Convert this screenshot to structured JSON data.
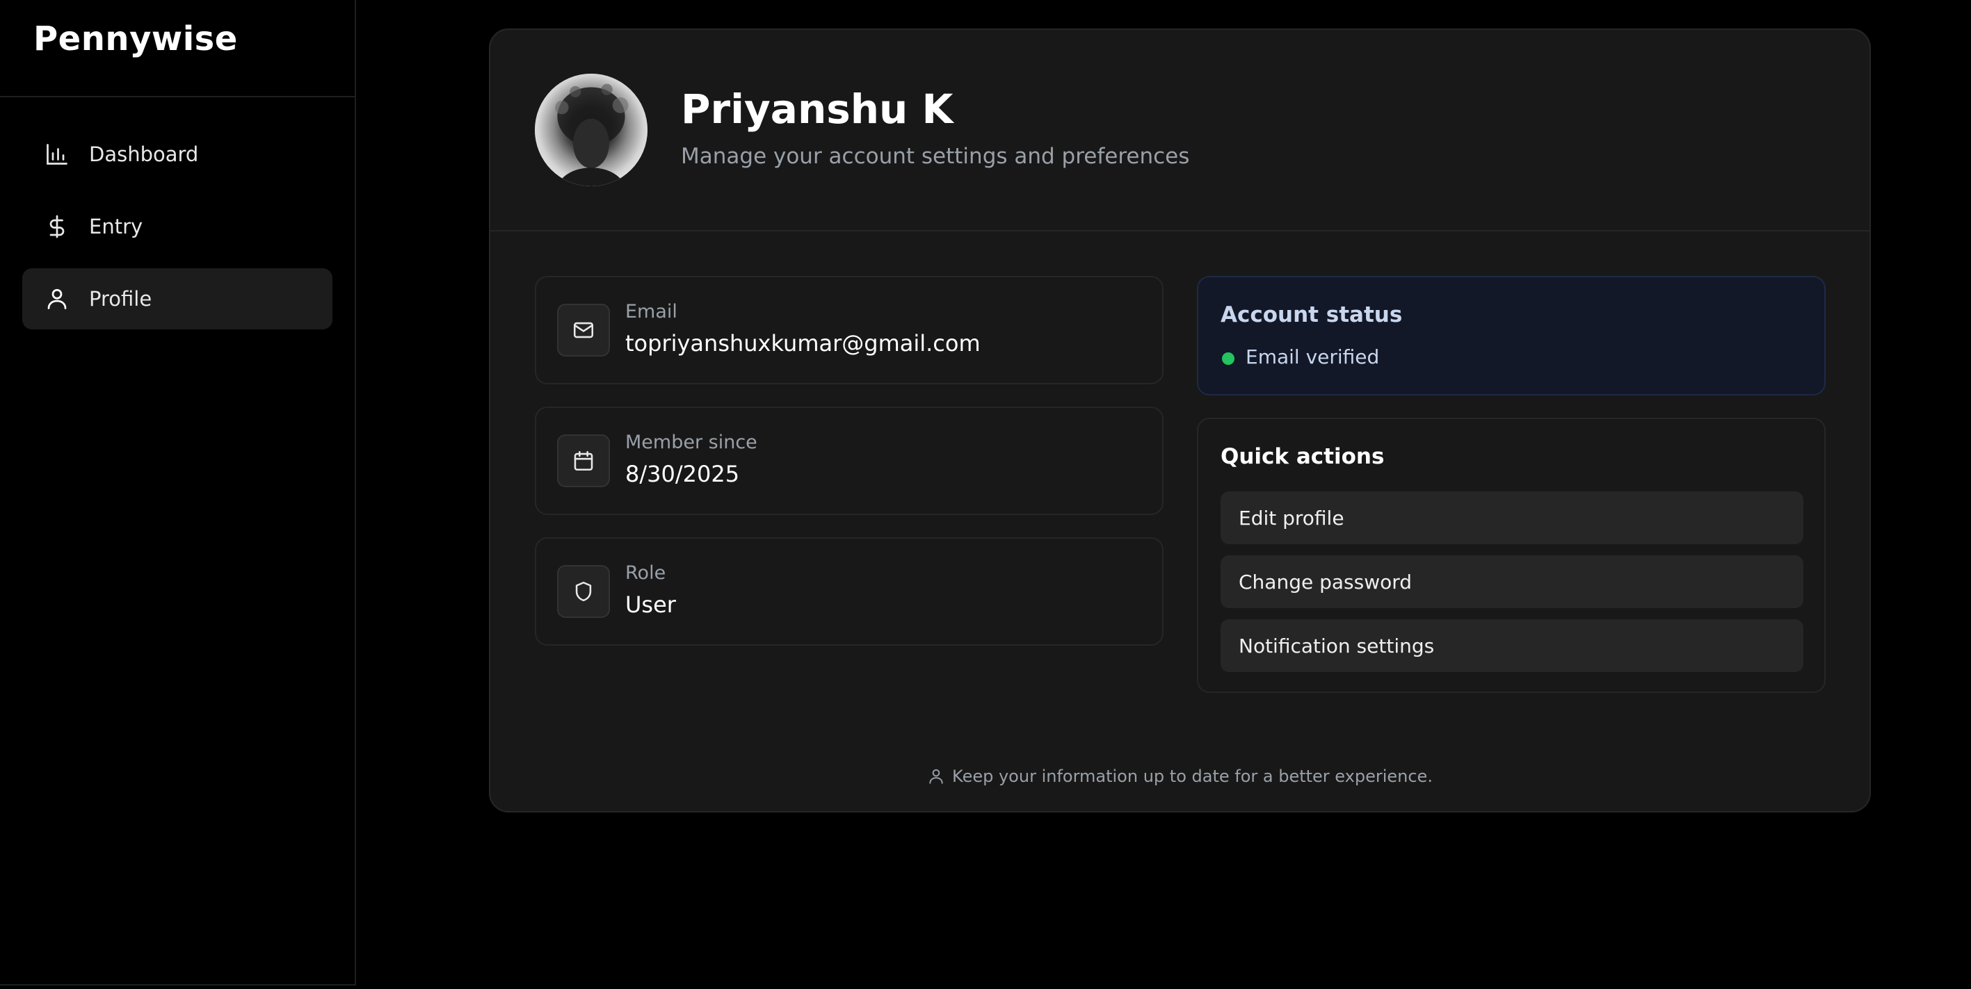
{
  "app": {
    "brand": "Pennywise"
  },
  "sidebar": {
    "items": [
      {
        "label": "Dashboard",
        "icon": "bar-chart-icon",
        "active": false
      },
      {
        "label": "Entry",
        "icon": "dollar-icon",
        "active": false
      },
      {
        "label": "Profile",
        "icon": "user-icon",
        "active": true
      }
    ]
  },
  "profile": {
    "name": "Priyanshu K",
    "subtitle": "Manage your account settings and preferences",
    "avatar_icon": "avatar-image"
  },
  "details": [
    {
      "label": "Email",
      "value": "topriyanshuxkumar@gmail.com",
      "icon": "mail-icon"
    },
    {
      "label": "Member since",
      "value": "8/30/2025",
      "icon": "calendar-icon"
    },
    {
      "label": "Role",
      "value": "User",
      "icon": "shield-icon"
    }
  ],
  "account_status": {
    "title": "Account status",
    "status": "Email verified",
    "status_color": "#22c55e"
  },
  "quick_actions": {
    "title": "Quick actions",
    "actions": [
      "Edit profile",
      "Change password",
      "Notification settings"
    ]
  },
  "footer": {
    "note": "Keep your information up to date for a better experience."
  }
}
